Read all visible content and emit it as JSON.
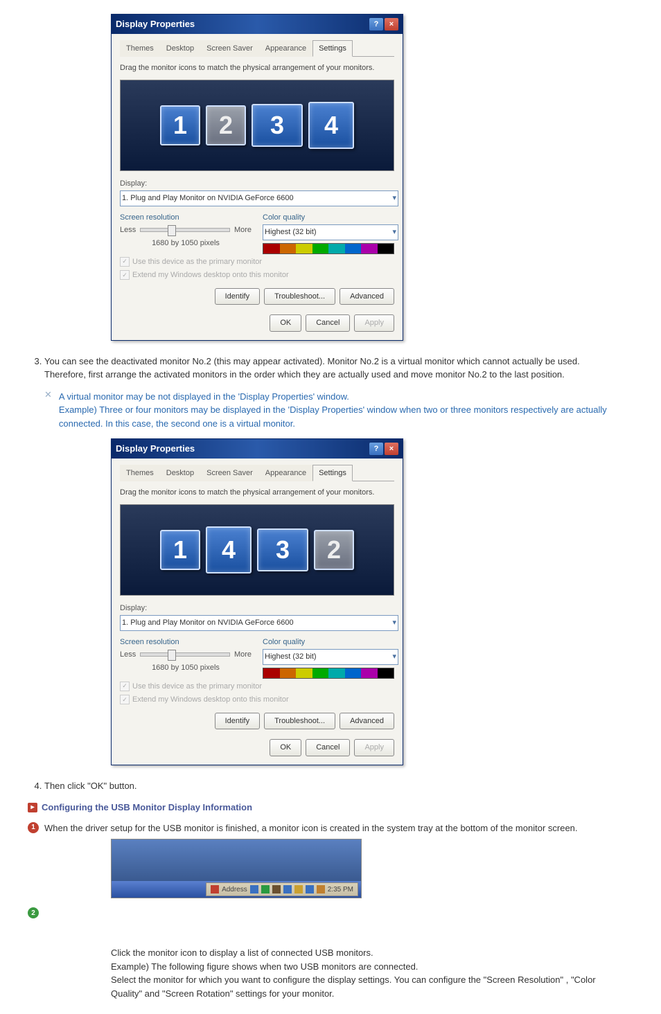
{
  "dialog": {
    "title": "Display Properties",
    "tabs": [
      "Themes",
      "Desktop",
      "Screen Saver",
      "Appearance",
      "Settings"
    ],
    "active_tab": "Settings",
    "drag_instruction": "Drag the monitor icons to match the physical arrangement of your monitors.",
    "display_label": "Display:",
    "display_value": "1. Plug and Play Monitor on NVIDIA GeForce 6600",
    "res_group": "Screen resolution",
    "less": "Less",
    "more": "More",
    "res_text": "1680 by 1050 pixels",
    "quality_group": "Color quality",
    "quality_value": "Highest (32 bit)",
    "cb1": "Use this device as the primary monitor",
    "cb2": "Extend my Windows desktop onto this monitor",
    "identify": "Identify",
    "troubleshoot": "Troubleshoot...",
    "advanced": "Advanced",
    "ok": "OK",
    "cancel": "Cancel",
    "apply": "Apply"
  },
  "monitors1": [
    "1",
    "2",
    "3",
    "4"
  ],
  "monitors2": [
    "1",
    "4",
    "3",
    "2"
  ],
  "step3_text": "You can see the deactivated monitor No.2 (this may appear activated). Monitor No.2 is a virtual monitor which cannot actually be used. Therefore, first arrange the activated monitors in the order which they are actually used and move monitor No.2 to the last position.",
  "step3_note1": "A virtual monitor may be not displayed in the 'Display Properties' window.",
  "step3_note2": "Example) Three or four monitors may be displayed in the 'Display Properties' window when two or three monitors respectively are actually connected. In this case, the second one is a virtual monitor.",
  "step4_text": "Then click \"OK\" button.",
  "section_header": "Configuring the USB Monitor Display Information",
  "bullet1": "When the driver setup for the USB monitor is finished, a monitor icon is created in the system tray at the bottom of the monitor screen.",
  "tray": {
    "address_label": "Address",
    "time": "2:35 PM"
  },
  "para1": "Click the monitor icon to display a list of connected USB monitors.",
  "para2": "Example) The following figure shows when two USB monitors are connected.",
  "para3": "Select the monitor for which you want to configure the display settings. You can configure the \"Screen Resolution\" , \"Color Quality\" and \"Screen Rotation\" settings for your monitor."
}
